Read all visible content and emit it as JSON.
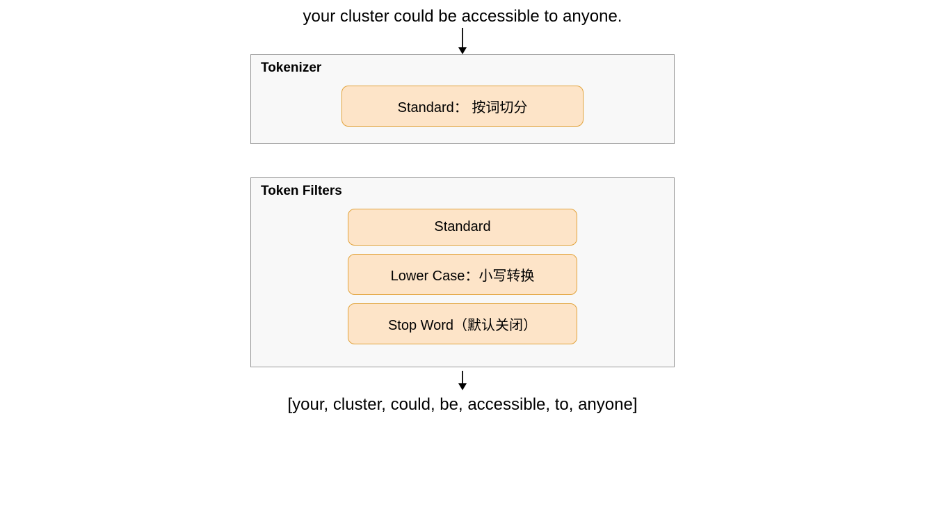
{
  "input_text": "your cluster could be accessible to anyone.",
  "tokenizer": {
    "title": "Tokenizer",
    "chip": "Standard： 按词切分"
  },
  "filters": {
    "title": "Token Filters",
    "items": [
      "Standard",
      "Lower Case：小写转换",
      "Stop Word（默认关闭）"
    ]
  },
  "output_text": "[your, cluster, could, be, accessible, to, anyone]"
}
